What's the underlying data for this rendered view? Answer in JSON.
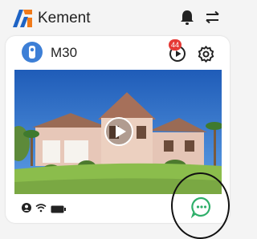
{
  "header": {
    "brand_name": "Kement",
    "icons": [
      "kement-logo",
      "bell-icon",
      "menu-icon"
    ]
  },
  "device_card": {
    "device_name": "M30",
    "unread_count": "44",
    "icons": [
      "camera-device-icon",
      "playback-icon",
      "settings-icon",
      "play-icon",
      "person-icon",
      "wifi-icon",
      "battery-icon",
      "chat-icon"
    ]
  },
  "colors": {
    "accent": "#2faf6a",
    "logo_blue": "#1e63c4",
    "logo_orange": "#f07a1a",
    "badge_red": "#e53935",
    "device_icon_blue": "#3d7fd6"
  }
}
